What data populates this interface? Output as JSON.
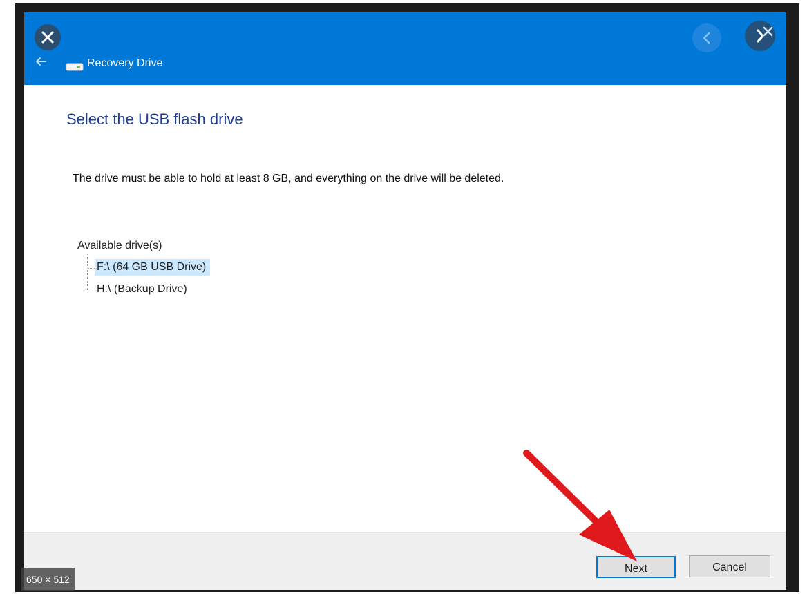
{
  "window": {
    "title": "Recovery Drive"
  },
  "page": {
    "heading": "Select the USB flash drive",
    "description": "The drive must be able to hold at least 8 GB, and everything on the drive will be deleted."
  },
  "drives": {
    "root_label": "Available drive(s)",
    "items": [
      {
        "label": "F:\\ (64 GB USB Drive)",
        "selected": true
      },
      {
        "label": "H:\\ (Backup Drive)",
        "selected": false
      }
    ]
  },
  "footer": {
    "next_label": "Next",
    "cancel_label": "Cancel"
  },
  "overlay": {
    "dimensions_badge": "650 × 512"
  },
  "colors": {
    "header_blue": "#0078d7",
    "heading_blue": "#1f3e98",
    "selection": "#cce8ff",
    "annotation_arrow": "#e0191d"
  },
  "icons": {
    "close": "close-icon",
    "back": "back-arrow-icon",
    "drive": "usb-drive-icon",
    "previous": "chevron-left-icon",
    "next": "chevron-right-icon",
    "window_close": "x-icon"
  }
}
